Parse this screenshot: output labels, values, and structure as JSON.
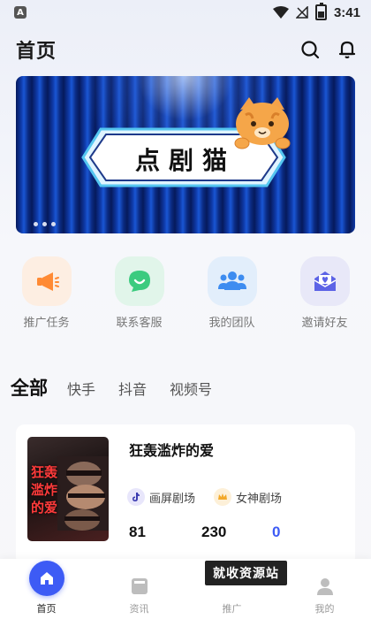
{
  "status_bar": {
    "app_icon_letter": "A",
    "time": "3:41"
  },
  "header": {
    "title": "首页"
  },
  "banner": {
    "text": "点剧猫",
    "slides": 3
  },
  "quick_menu": [
    {
      "label": "推广任务",
      "icon": "megaphone-icon",
      "bg": "#fdeee2",
      "color": "#ff8a34"
    },
    {
      "label": "联系客服",
      "icon": "chat-smile-icon",
      "bg": "#e1f5ea",
      "color": "#3ccb7f"
    },
    {
      "label": "我的团队",
      "icon": "team-icon",
      "bg": "#e2eefb",
      "color": "#3d8cf0"
    },
    {
      "label": "邀请好友",
      "icon": "invite-envelope-icon",
      "bg": "#e8e8f8",
      "color": "#5c63e6"
    }
  ],
  "tabs": [
    {
      "label": "全部",
      "active": true
    },
    {
      "label": "快手",
      "active": false
    },
    {
      "label": "抖音",
      "active": false
    },
    {
      "label": "视频号",
      "active": false
    }
  ],
  "card": {
    "title": "狂轰滥炸的爱",
    "poster_text": "狂轰滥炸的爱",
    "tags": [
      {
        "label": "画屏剧场",
        "icon": "tiktok-icon"
      },
      {
        "label": "女神剧场",
        "icon": "crown-icon"
      }
    ],
    "stats": [
      "81",
      "230",
      "0"
    ]
  },
  "bottom_nav": [
    {
      "label": "首页",
      "icon": "home-icon",
      "active": true
    },
    {
      "label": "资讯",
      "icon": "news-icon",
      "active": false
    },
    {
      "label": "推广",
      "icon": "promote-icon",
      "active": false
    },
    {
      "label": "我的",
      "icon": "user-icon",
      "active": false
    }
  ],
  "watermark": "就收资源站",
  "colors": {
    "accent": "#3d5bf5",
    "stat_highlight": "#3d5bf5"
  }
}
